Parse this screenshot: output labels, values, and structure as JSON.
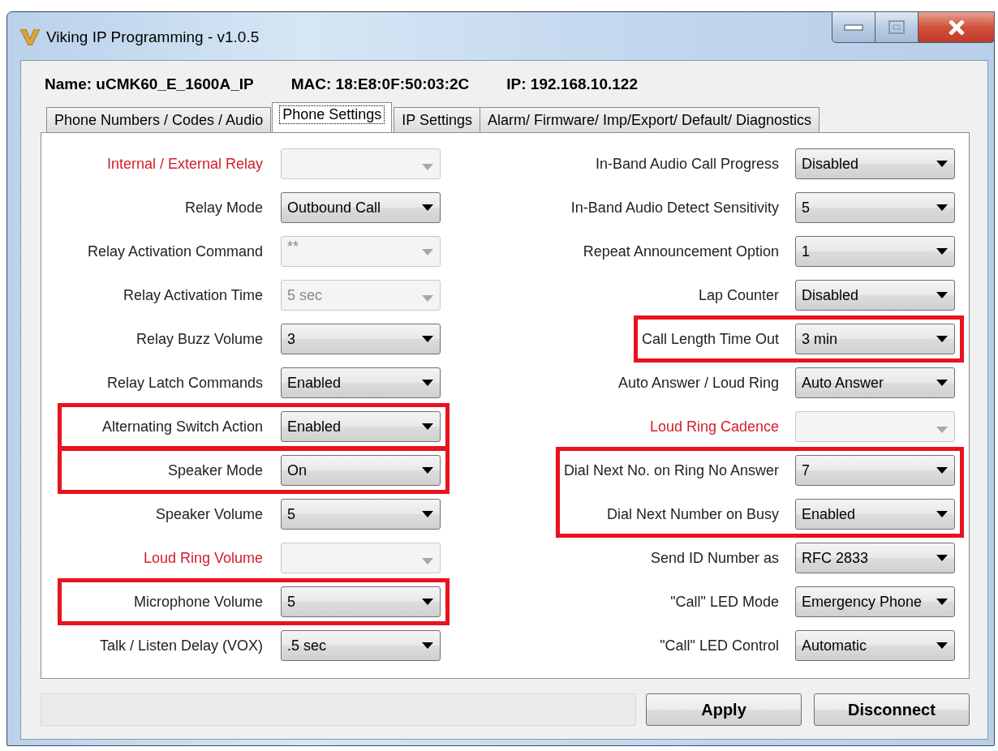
{
  "window": {
    "title": "Viking IP Programming - v1.0.5"
  },
  "header": {
    "name": "Name: uCMK60_E_1600A_IP",
    "mac": "MAC: 18:E8:0F:50:03:2C",
    "ip": "IP: 192.168.10.122"
  },
  "tabs": [
    {
      "label": "Phone Numbers / Codes / Audio",
      "selected": false
    },
    {
      "label": "Phone Settings",
      "selected": true
    },
    {
      "label": "IP Settings",
      "selected": false
    },
    {
      "label": "Alarm/ Firmware/ Imp/Export/ Default/ Diagnostics",
      "selected": false
    }
  ],
  "left_fields": [
    {
      "kind": "field",
      "label": "Internal / External Relay",
      "flagged": true,
      "disabled": true
    },
    {
      "kind": "field",
      "label": "Relay Mode",
      "value": "Outbound Call",
      "flagged": false,
      "disabled": false
    },
    {
      "kind": "field",
      "label": "Relay Activation Command",
      "value": "**",
      "flagged": false,
      "disabled": true
    },
    {
      "kind": "field",
      "label": "Relay Activation Time",
      "value": "5 sec",
      "flagged": false,
      "disabled": true
    },
    {
      "kind": "field",
      "label": "Relay Buzz Volume",
      "value": "3",
      "flagged": false,
      "disabled": false
    },
    {
      "kind": "field",
      "label": "Relay Latch Commands",
      "value": "Enabled",
      "flagged": false,
      "disabled": false
    },
    {
      "kind": "highlight_box",
      "fields": [
        {
          "label": "Alternating Switch Action",
          "value": "Enabled",
          "flagged": false,
          "disabled": false
        }
      ]
    },
    {
      "kind": "highlight_box",
      "fields": [
        {
          "label": "Speaker Mode",
          "value": "On",
          "flagged": false,
          "disabled": false
        }
      ]
    },
    {
      "kind": "field",
      "label": "Speaker Volume",
      "value": "5",
      "flagged": false,
      "disabled": false
    },
    {
      "kind": "field",
      "label": "Loud Ring Volume",
      "flagged": true,
      "disabled": true
    },
    {
      "kind": "highlight_box",
      "fields": [
        {
          "label": "Microphone Volume",
          "value": "5",
          "flagged": false,
          "disabled": false
        }
      ]
    },
    {
      "kind": "field",
      "label": "Talk / Listen Delay (VOX)",
      "value": ".5 sec",
      "flagged": false,
      "disabled": false
    }
  ],
  "right_fields": [
    {
      "kind": "field",
      "label": "In-Band Audio Call Progress",
      "value": "Disabled",
      "flagged": false,
      "disabled": false
    },
    {
      "kind": "field",
      "label": "In-Band Audio Detect Sensitivity",
      "value": "5",
      "flagged": false,
      "disabled": false
    },
    {
      "kind": "field",
      "label": "Repeat Announcement Option",
      "value": "1",
      "flagged": false,
      "disabled": false
    },
    {
      "kind": "field",
      "label": "Lap Counter",
      "value": "Disabled",
      "flagged": false,
      "disabled": false
    },
    {
      "kind": "highlight_box",
      "fields": [
        {
          "label": "Call Length Time Out",
          "value": "3 min",
          "flagged": false,
          "disabled": false
        }
      ]
    },
    {
      "kind": "field",
      "label": "Auto Answer / Loud Ring",
      "value": "Auto Answer",
      "flagged": false,
      "disabled": false
    },
    {
      "kind": "field",
      "label": "Loud Ring Cadence",
      "flagged": true,
      "disabled": true
    },
    {
      "kind": "highlight_box",
      "fields": [
        {
          "label": "Dial Next No. on Ring No Answer",
          "value": "7",
          "flagged": false,
          "disabled": false
        },
        {
          "label": "Dial Next Number on Busy",
          "value": "Enabled",
          "flagged": false,
          "disabled": false
        }
      ]
    },
    {
      "kind": "field",
      "label": "Send ID Number as",
      "value": "RFC 2833",
      "flagged": false,
      "disabled": false
    },
    {
      "kind": "field",
      "label": "\"Call\" LED Mode",
      "value": "Emergency Phone",
      "flagged": false,
      "disabled": false
    },
    {
      "kind": "field",
      "label": "\"Call\" LED Control",
      "value": "Automatic",
      "flagged": false,
      "disabled": false
    }
  ],
  "buttons": [
    {
      "label": "Apply"
    },
    {
      "label": "Disconnect"
    }
  ]
}
